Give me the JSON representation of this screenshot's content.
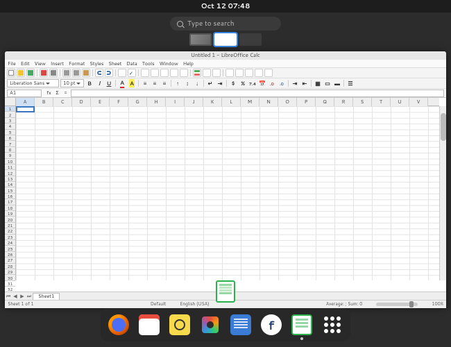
{
  "topbar": {
    "datetime": "Oct 12  07:48"
  },
  "search": {
    "placeholder": "Type to search"
  },
  "window": {
    "title": "Untitled 1 - LibreOffice Calc",
    "menus": [
      "File",
      "Edit",
      "View",
      "Insert",
      "Format",
      "Styles",
      "Sheet",
      "Data",
      "Tools",
      "Window",
      "Help"
    ],
    "font_name": "Liberation Sans",
    "font_size": "10 pt",
    "name_box": "A1",
    "columns": [
      "A",
      "B",
      "C",
      "D",
      "E",
      "F",
      "G",
      "H",
      "I",
      "J",
      "K",
      "L",
      "M",
      "N",
      "O",
      "P",
      "Q",
      "R",
      "S",
      "T",
      "U",
      "V"
    ],
    "row_count": 32,
    "selected_cell": "A1",
    "sheet_tab": "Sheet1",
    "fx_label": "fx",
    "sigma_label": "Σ",
    "status": {
      "sheet_of": "Sheet 1 of 1",
      "style": "Default",
      "lang": "English (USA)",
      "summary": "Average: ; Sum: 0",
      "zoom": "100%"
    }
  },
  "dock": {
    "items": [
      {
        "name": "firefox",
        "label": "Firefox"
      },
      {
        "name": "calendar",
        "label": "Calendar"
      },
      {
        "name": "music",
        "label": "Rhythmbox"
      },
      {
        "name": "photos",
        "label": "Photos"
      },
      {
        "name": "text-editor",
        "label": "Text Editor"
      },
      {
        "name": "fedora-software",
        "label": "Software"
      },
      {
        "name": "libreoffice-calc",
        "label": "LibreOffice Calc",
        "running": true
      },
      {
        "name": "show-applications",
        "label": "Show Applications"
      }
    ]
  }
}
